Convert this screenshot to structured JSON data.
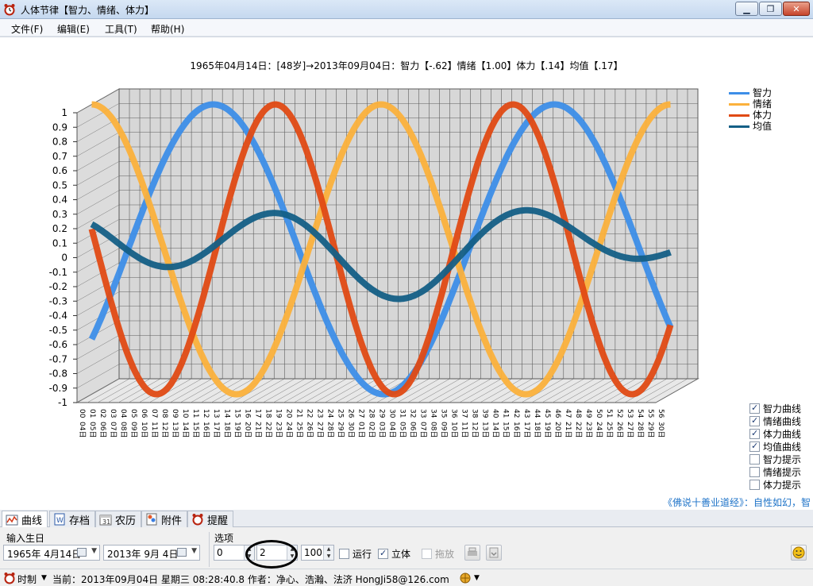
{
  "window": {
    "title": "人体节律【智力、情绪、体力】",
    "min_label": "▁",
    "max_label": "❐",
    "close_label": "✕"
  },
  "menu": [
    "文件(F)",
    "编辑(E)",
    "工具(T)",
    "帮助(H)"
  ],
  "chart_title": "1965年04月14日：[48岁]→2013年09月04日：智力【-.62】情绪【1.00】体力【.14】均值【.17】",
  "chart_data": {
    "type": "line",
    "ylim": [
      -1,
      1
    ],
    "yticks": [
      "1",
      "0.9",
      "0.8",
      "0.7",
      "0.6",
      "0.5",
      "0.4",
      "0.3",
      "0.2",
      "0.1",
      "0",
      "-0.1",
      "-0.2",
      "-0.3",
      "-0.4",
      "-0.5",
      "-0.6",
      "-0.7",
      "-0.8",
      "-0.9",
      "-1"
    ],
    "x_labels": [
      "04日",
      "05日",
      "06日",
      "07日",
      "08日",
      "09日",
      "10日",
      "11日",
      "12日",
      "13日",
      "14日",
      "15日",
      "16日",
      "17日",
      "18日",
      "19日",
      "20日",
      "21日",
      "22日",
      "23日",
      "24日",
      "25日",
      "26日",
      "27日",
      "28日",
      "29日",
      "30日",
      "01日",
      "02日",
      "03日",
      "04日",
      "05日",
      "06日",
      "07日",
      "08日",
      "09日",
      "10日",
      "11日",
      "12日",
      "13日",
      "14日",
      "15日",
      "16日",
      "17日",
      "18日",
      "19日",
      "20日",
      "21日",
      "22日",
      "23日",
      "24日",
      "25日",
      "26日",
      "27日",
      "28日",
      "29日",
      "30日"
    ],
    "x_index": [
      "00",
      "01",
      "02",
      "03",
      "04",
      "05",
      "06",
      "07",
      "08",
      "09",
      "10",
      "11",
      "12",
      "13",
      "14",
      "15",
      "16",
      "17",
      "18",
      "19",
      "20",
      "21",
      "22",
      "23",
      "24",
      "25",
      "26",
      "27",
      "28",
      "29",
      "30",
      "31",
      "32",
      "33",
      "34",
      "35",
      "36",
      "37",
      "38",
      "39",
      "40",
      "41",
      "42",
      "43",
      "44",
      "45",
      "46",
      "47",
      "48",
      "49",
      "50",
      "51",
      "52",
      "53",
      "54",
      "55",
      "56"
    ],
    "series": [
      {
        "name": "智力",
        "color": "#3d8ee8",
        "start": -0.62,
        "period": 33,
        "phase_dir": 1
      },
      {
        "name": "情绪",
        "color": "#fbb13c",
        "start": 1.0,
        "period": 28,
        "phase_dir": 1
      },
      {
        "name": "体力",
        "color": "#e04a14",
        "start": 0.14,
        "period": 23,
        "phase_dir": -1
      },
      {
        "name": "均值",
        "color": "#145f86",
        "start": 0.17,
        "period": 0,
        "phase_dir": 0
      }
    ],
    "three_d": true,
    "grid": true,
    "legend": "top-right"
  },
  "checklist": [
    {
      "label": "智力曲线",
      "checked": true
    },
    {
      "label": "情绪曲线",
      "checked": true
    },
    {
      "label": "体力曲线",
      "checked": true
    },
    {
      "label": "均值曲线",
      "checked": true
    },
    {
      "label": "智力提示",
      "checked": false
    },
    {
      "label": "情绪提示",
      "checked": false
    },
    {
      "label": "体力提示",
      "checked": false
    }
  ],
  "marquee": "《佛说十善业道经》：自性如幻，智",
  "tabs": [
    "曲线",
    "存档",
    "农历",
    "附件",
    "提醒"
  ],
  "panel": {
    "birth_label": "输入生日",
    "options_label": "选项",
    "birth_date": "1965年 4月14日",
    "target_date": "2013年 9月 4日",
    "spin1": "0",
    "spin2": "2",
    "spin3": "100",
    "run_label": "运行",
    "threed_label": "立体",
    "drag_label": "拖放"
  },
  "status": {
    "mode": "时制",
    "text": "当前：2013年09月04日 星期三 08:28:40.8  作者：净心、浩瀚、法济  HongJi58@126.com"
  }
}
